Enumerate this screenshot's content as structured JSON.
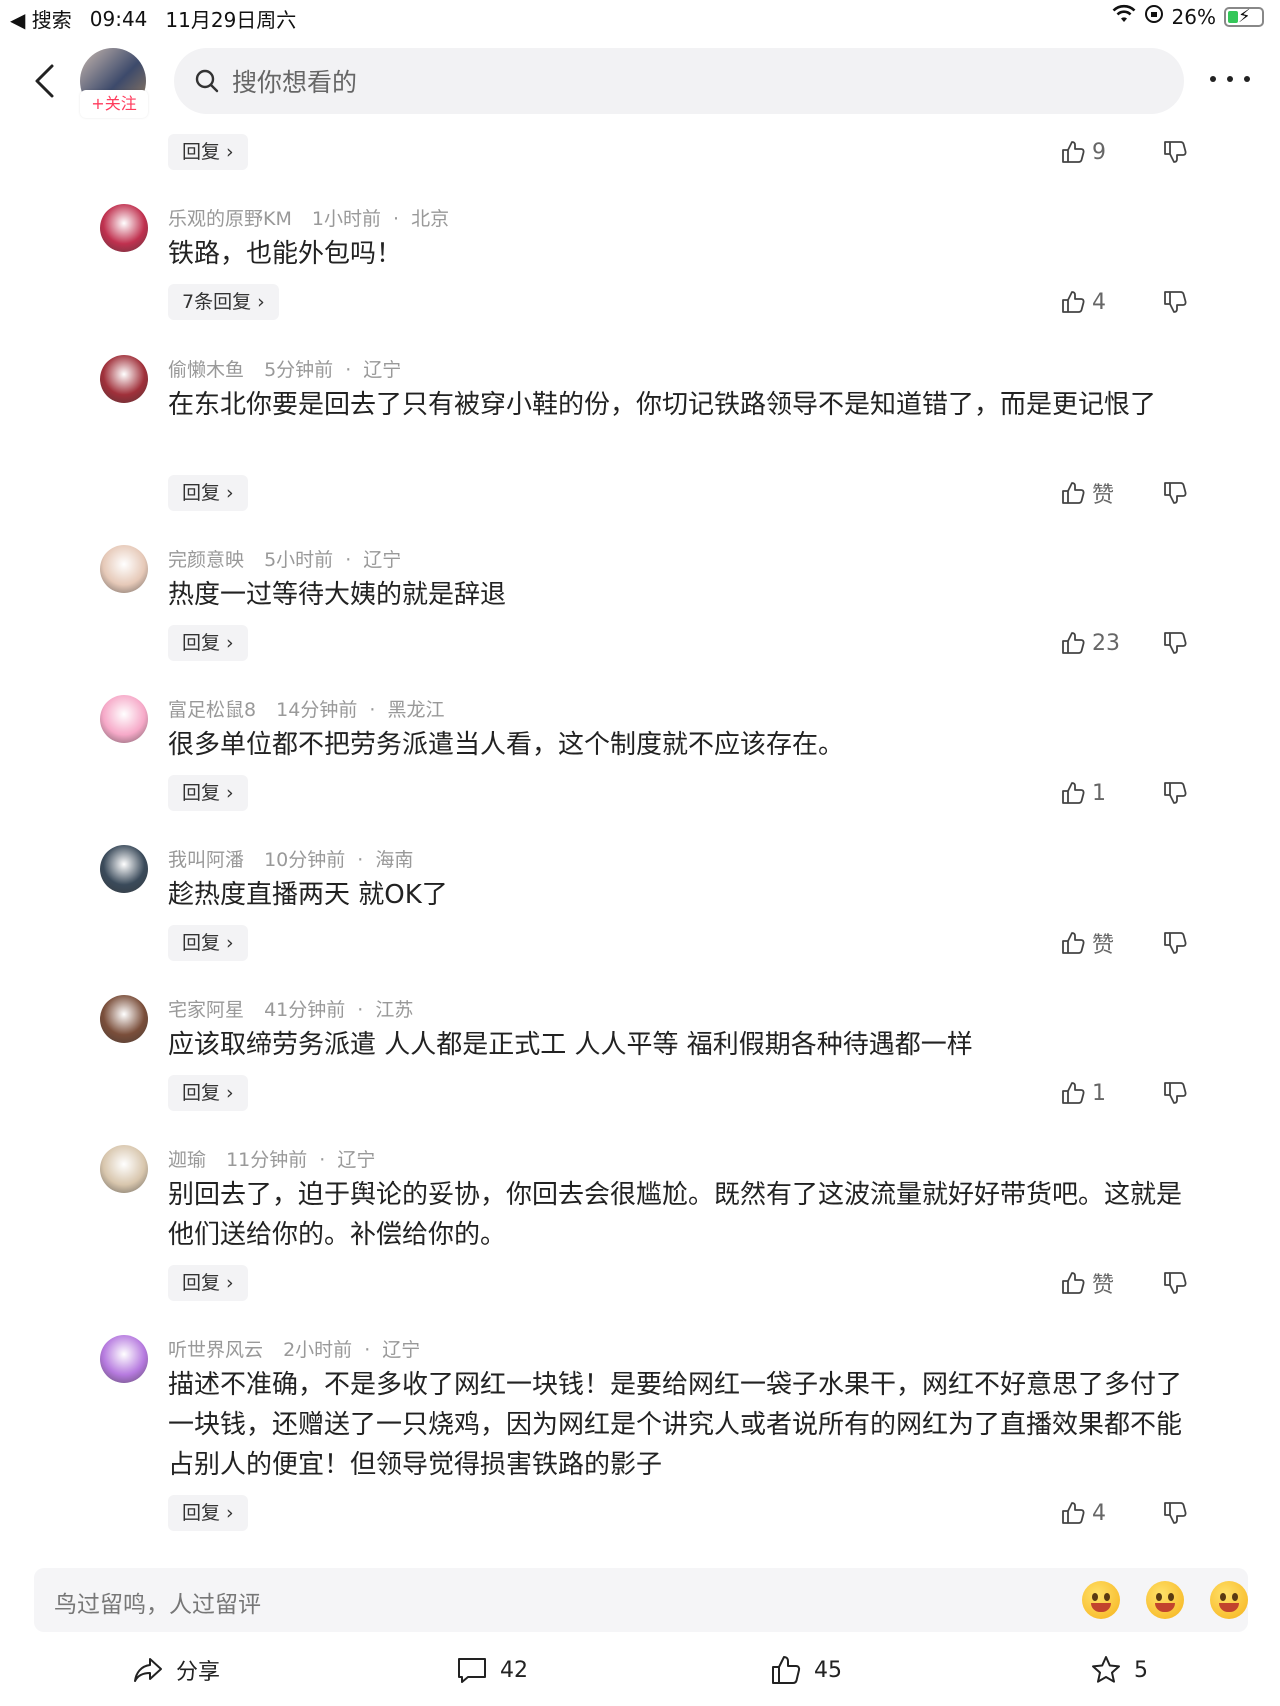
{
  "status_bar": {
    "back_app": "◀ 搜索",
    "time": "09:44",
    "date": "11月29日周六",
    "battery": "26%"
  },
  "header": {
    "follow_label": "+关注",
    "search_placeholder": "搜你想看的"
  },
  "first_row": {
    "reply_label": "回复",
    "likes": "9"
  },
  "comments": [
    {
      "user": "乐观的原野KM",
      "time": "1小时前",
      "location": "北京",
      "text": "铁路，也能外包吗！",
      "reply_label": "7条回复",
      "likes": "4",
      "avatar_color": "#c0314f"
    },
    {
      "user": "偷懒木鱼",
      "time": "5分钟前",
      "location": "辽宁",
      "text": "在东北你要是回去了只有被穿小鞋的份，你切记铁路领导不是知道错了，而是更记恨了",
      "reply_label": "回复",
      "likes": "赞",
      "avatar_color": "#a0303a"
    },
    {
      "user": "完颜意映",
      "time": "5小时前",
      "location": "辽宁",
      "text": "热度一过等待大姨的就是辞退",
      "reply_label": "回复",
      "likes": "23",
      "avatar_color": "#e6c9b8"
    },
    {
      "user": "富足松鼠8",
      "time": "14分钟前",
      "location": "黑龙江",
      "text": "很多单位都不把劳务派遣当人看，这个制度就不应该存在。",
      "reply_label": "回复",
      "likes": "1",
      "avatar_color": "#f6a9c8"
    },
    {
      "user": "我叫阿潘",
      "time": "10分钟前",
      "location": "海南",
      "text": "趁热度直播两天 就OK了",
      "reply_label": "回复",
      "likes": "赞",
      "avatar_color": "#3a4a5a"
    },
    {
      "user": "宅家阿星",
      "time": "41分钟前",
      "location": "江苏",
      "text": "应该取缔劳务派遣 人人都是正式工 人人平等 福利假期各种待遇都一样",
      "reply_label": "回复",
      "likes": "1",
      "avatar_color": "#7a4e3a"
    },
    {
      "user": "迦瑜",
      "time": "11分钟前",
      "location": "辽宁",
      "text": "别回去了，迫于舆论的妥协，你回去会很尴尬。既然有了这波流量就好好带货吧。这就是他们送给你的。补偿给你的。",
      "reply_label": "回复",
      "likes": "赞",
      "avatar_color": "#d8c6ad"
    },
    {
      "user": "听世界风云",
      "time": "2小时前",
      "location": "辽宁",
      "text": "描述不准确，不是多收了网红一块钱！是要给网红一袋子水果干，网红不好意思了多付了一块钱，还赠送了一只烧鸡，因为网红是个讲究人或者说所有的网红为了直播效果都不能占别人的便宜！但领导觉得损害铁路的影子",
      "reply_label": "回复",
      "likes": "4",
      "avatar_color": "#b67adf"
    }
  ],
  "input_bar": {
    "placeholder": "鸟过留鸣，人过留评"
  },
  "bottom_bar": {
    "share_label": "分享",
    "comments_count": "42",
    "likes_count": "45",
    "favorites_count": "5"
  }
}
